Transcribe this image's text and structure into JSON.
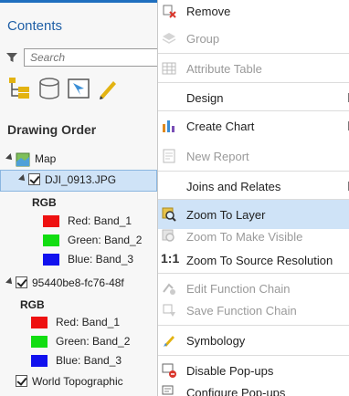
{
  "contents": {
    "title": "Contents",
    "search_placeholder": "Search",
    "section_title": "Drawing Order",
    "map_label": "Map",
    "layers": [
      {
        "name": "DJI_0913.JPG",
        "renderer": "RGB",
        "bands": [
          {
            "label": "Red: Band_1",
            "color": "#ee1111"
          },
          {
            "label": "Green: Band_2",
            "color": "#11dd11"
          },
          {
            "label": "Blue: Band_3",
            "color": "#1111ee"
          }
        ]
      },
      {
        "name": "95440be8-fc76-48f",
        "renderer": "RGB",
        "bands": [
          {
            "label": "Red: Band_1",
            "color": "#ee1111"
          },
          {
            "label": "Green: Band_2",
            "color": "#11dd11"
          },
          {
            "label": "Blue: Band_3",
            "color": "#1111ee"
          }
        ]
      },
      {
        "name": "World Topographic"
      }
    ]
  },
  "menu": {
    "items": {
      "remove": "Remove",
      "group": "Group",
      "attribute_table": "Attribute Table",
      "design": "Design",
      "create_chart": "Create Chart",
      "new_report": "New Report",
      "joins_relates": "Joins and Relates",
      "zoom_to_layer": "Zoom To Layer",
      "zoom_visible": "Zoom To Make Visible",
      "zoom_source": "Zoom To Source Resolution",
      "source_icon_text": "1:1",
      "edit_function": "Edit Function Chain",
      "save_function": "Save Function Chain",
      "symbology": "Symbology",
      "disable_popups": "Disable Pop-ups",
      "configure_popups": "Configure Pop-ups"
    }
  },
  "colors": {
    "accent": "#1f5fa6",
    "selection": "#cfe3f7"
  }
}
